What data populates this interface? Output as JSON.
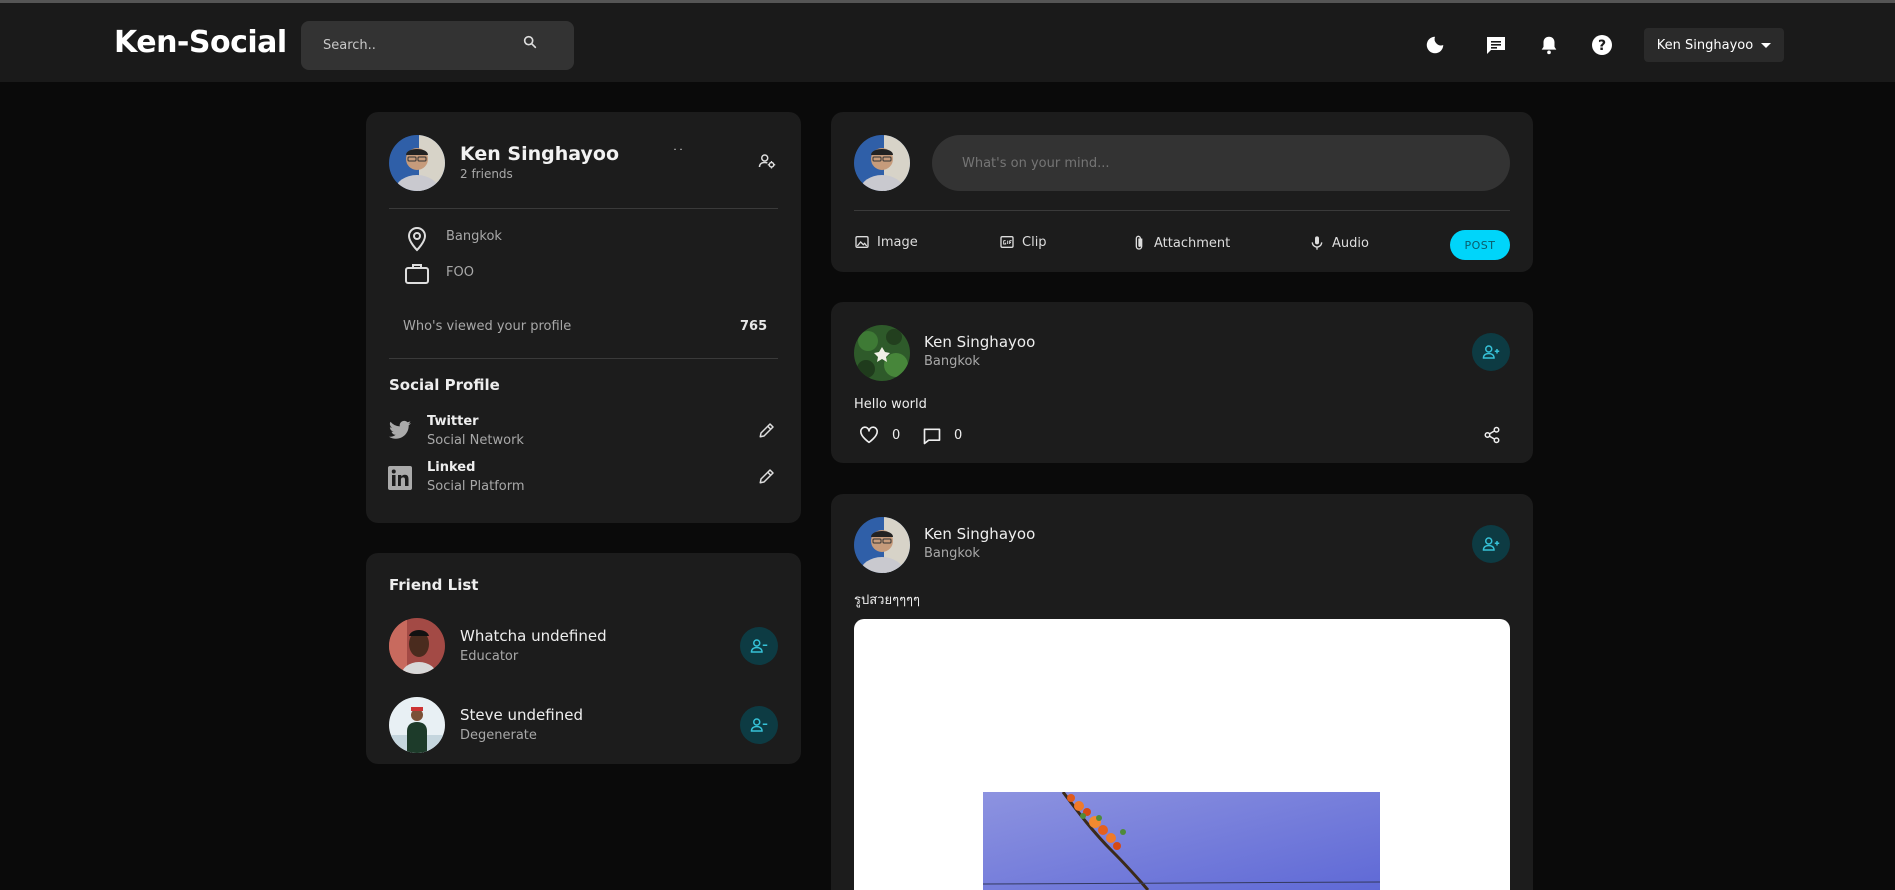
{
  "navbar": {
    "logo": "Ken-Social",
    "search_placeholder": "Search..",
    "icons": [
      "moon-icon",
      "message-icon",
      "bell-icon",
      "help-icon"
    ],
    "user_name": "Ken Singhayoo"
  },
  "profile": {
    "name": "Ken Singhayoo",
    "friends": "2 friends",
    "location": "Bangkok",
    "occupation": "FOO",
    "viewed_label": "Who's viewed your profile",
    "viewed_count": "765",
    "social_title": "Social Profile",
    "socials": [
      {
        "name": "Twitter",
        "type": "Social Network"
      },
      {
        "name": "Linked",
        "type": "Social Platform"
      }
    ]
  },
  "friend_list": {
    "title": "Friend List",
    "friends": [
      {
        "name": "Whatcha undefined",
        "role": "Educator"
      },
      {
        "name": "Steve undefined",
        "role": "Degenerate"
      }
    ]
  },
  "composer": {
    "placeholder": "What's on your mind...",
    "tools": [
      "Image",
      "Clip",
      "Attachment",
      "Audio"
    ],
    "post_label": "POST"
  },
  "posts": [
    {
      "author": "Ken Singhayoo",
      "location": "Bangkok",
      "text": "Hello world",
      "likes": "0",
      "comments": "0"
    },
    {
      "author": "Ken Singhayoo",
      "location": "Bangkok",
      "text": "รูปสวยๆๆๆๆ"
    }
  ],
  "colors": {
    "background": "#0a0a0a",
    "card": "#1c1c1c",
    "navbar": "#1a1a1a",
    "accent": "#00d5fa",
    "friend_button": "#0d3b43"
  }
}
